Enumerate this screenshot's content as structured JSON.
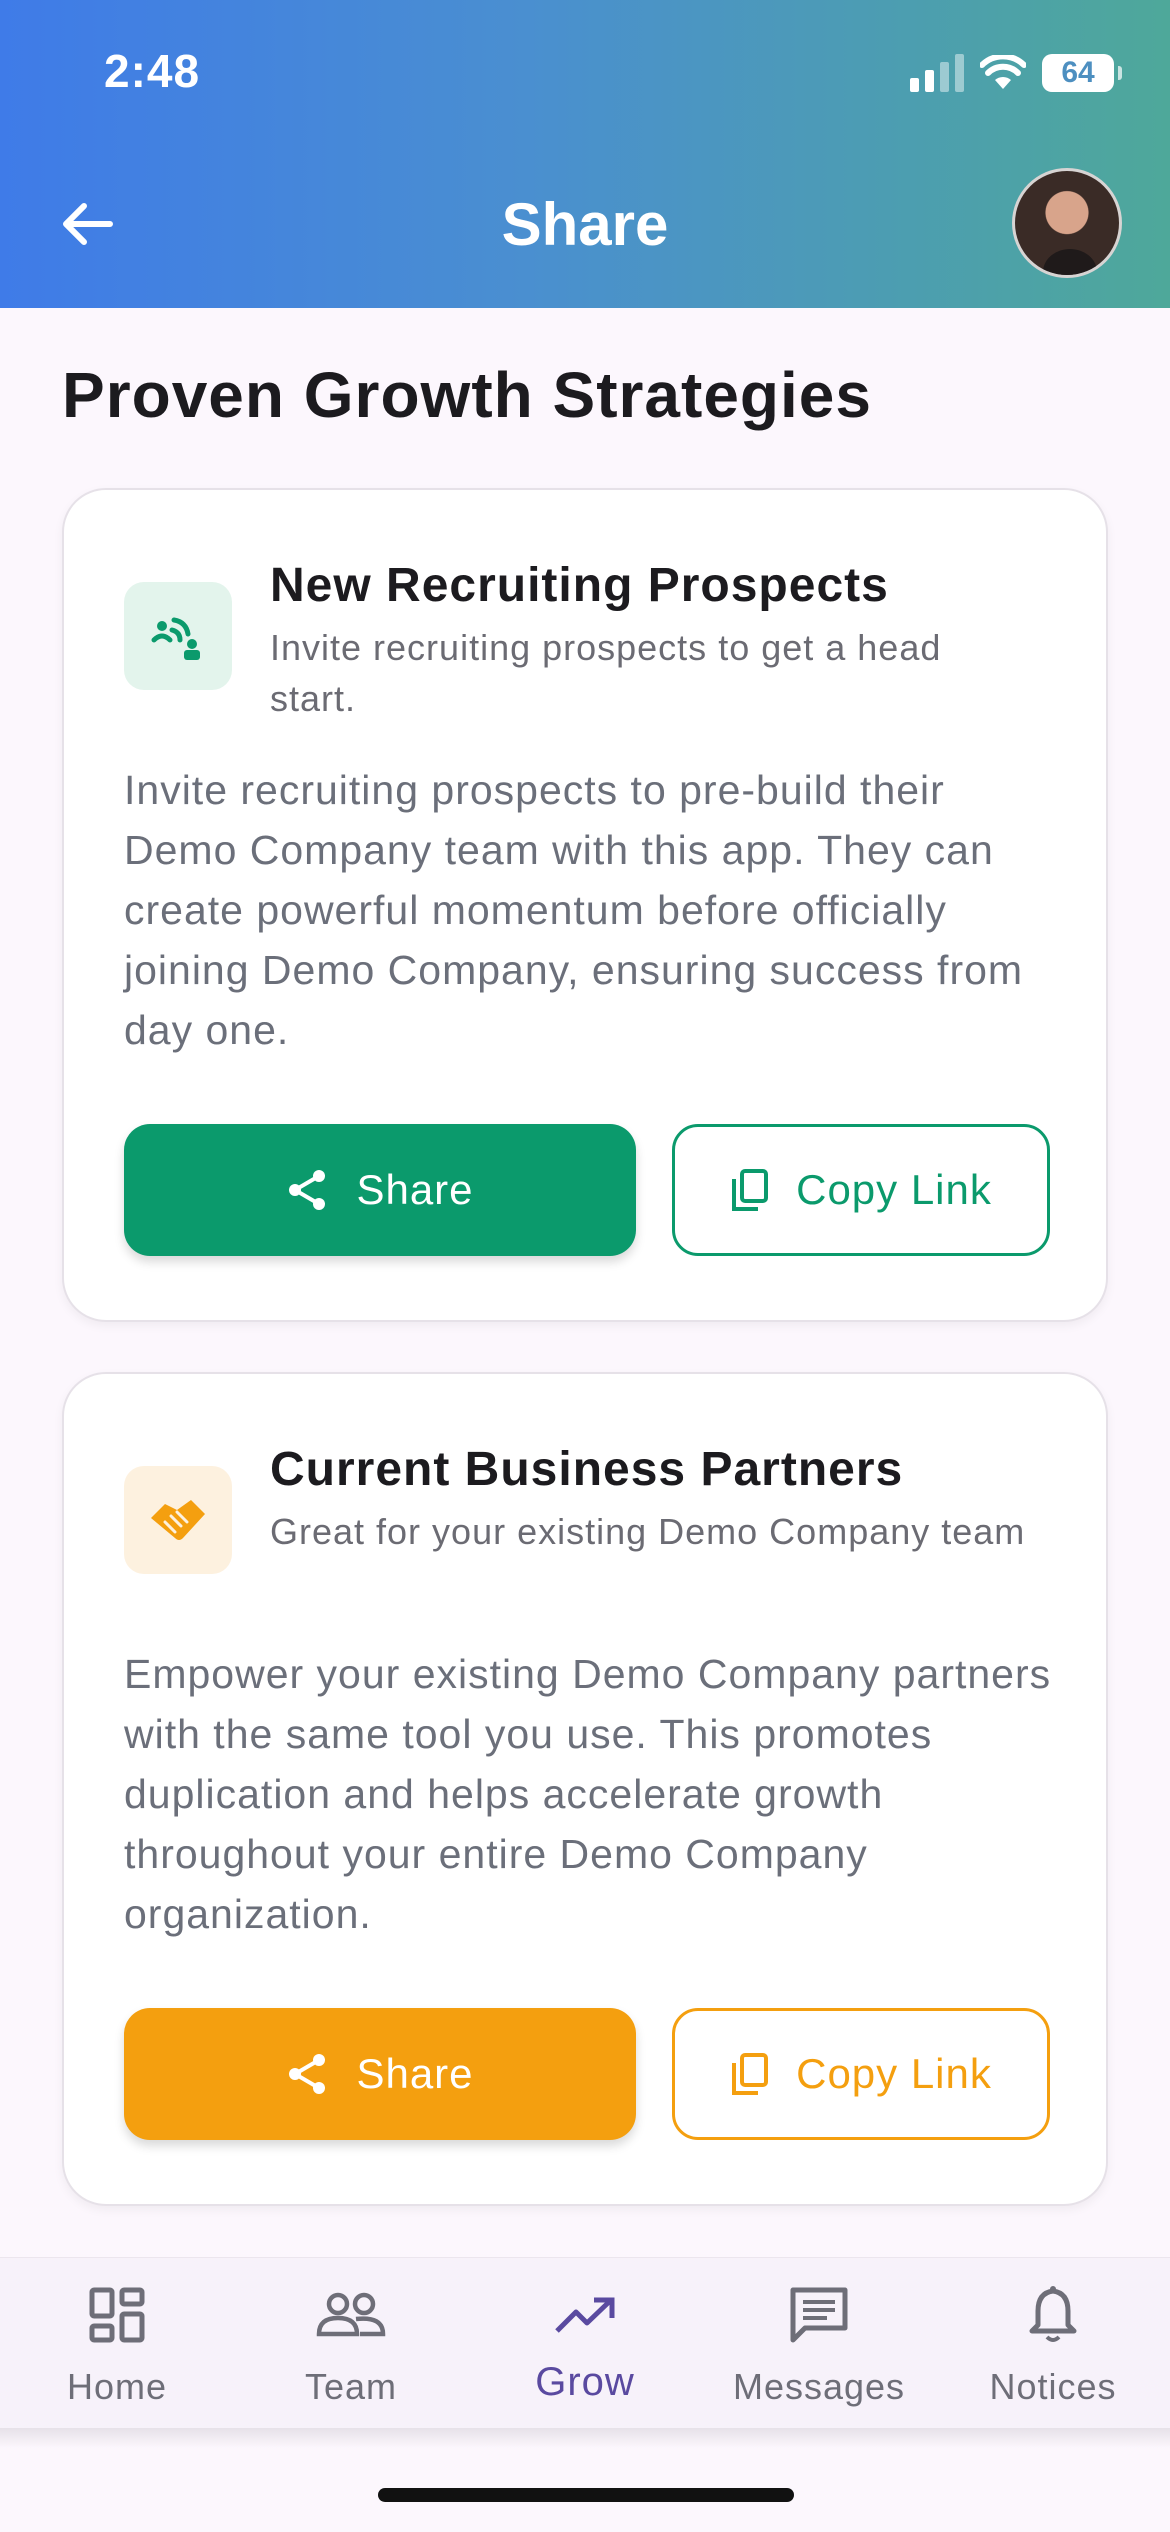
{
  "status_bar": {
    "time": "2:48",
    "battery": "64"
  },
  "header": {
    "title": "Share"
  },
  "page": {
    "title": "Proven Growth Strategies"
  },
  "cards": [
    {
      "title": "New Recruiting Prospects",
      "subtitle": "Invite recruiting prospects to get a head start.",
      "body": "Invite recruiting prospects to pre-build their Demo Company team with this app. They can create powerful momentum before officially joining Demo Company, ensuring success from day one.",
      "share_label": "Share",
      "copy_label": "Copy Link",
      "icon": "recruit-signal-icon",
      "accent": "#0b9a6c"
    },
    {
      "title": "Current Business Partners",
      "subtitle": "Great for your existing Demo Company team",
      "body": "Empower your existing Demo Company partners with the same tool you use. This promotes duplication and helps accelerate growth throughout your entire Demo Company organization.",
      "share_label": "Share",
      "copy_label": "Copy Link",
      "icon": "handshake-icon",
      "accent": "#f49f0f"
    }
  ],
  "nav": {
    "items": [
      {
        "label": "Home",
        "icon": "dashboard-icon"
      },
      {
        "label": "Team",
        "icon": "team-icon"
      },
      {
        "label": "Grow",
        "icon": "trending-up-icon",
        "active": true
      },
      {
        "label": "Messages",
        "icon": "message-icon"
      },
      {
        "label": "Notices",
        "icon": "bell-icon"
      }
    ]
  }
}
